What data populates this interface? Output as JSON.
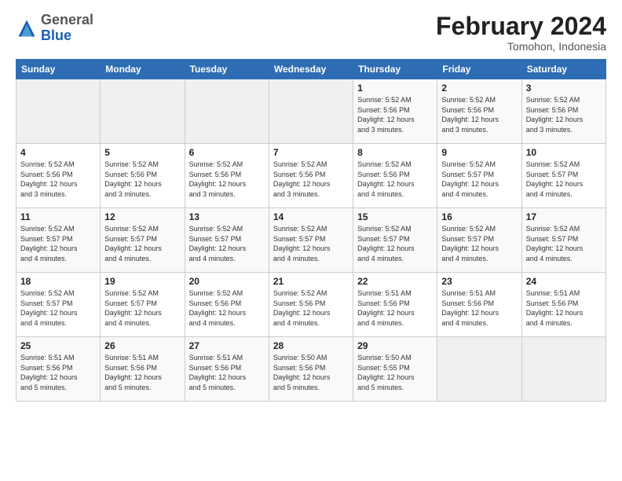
{
  "header": {
    "logo_general": "General",
    "logo_blue": "Blue",
    "month_title": "February 2024",
    "location": "Tomohon, Indonesia"
  },
  "days_of_week": [
    "Sunday",
    "Monday",
    "Tuesday",
    "Wednesday",
    "Thursday",
    "Friday",
    "Saturday"
  ],
  "weeks": [
    [
      {
        "day": "",
        "info": ""
      },
      {
        "day": "",
        "info": ""
      },
      {
        "day": "",
        "info": ""
      },
      {
        "day": "",
        "info": ""
      },
      {
        "day": "1",
        "info": "Sunrise: 5:52 AM\nSunset: 5:56 PM\nDaylight: 12 hours\nand 3 minutes."
      },
      {
        "day": "2",
        "info": "Sunrise: 5:52 AM\nSunset: 5:56 PM\nDaylight: 12 hours\nand 3 minutes."
      },
      {
        "day": "3",
        "info": "Sunrise: 5:52 AM\nSunset: 5:56 PM\nDaylight: 12 hours\nand 3 minutes."
      }
    ],
    [
      {
        "day": "4",
        "info": "Sunrise: 5:52 AM\nSunset: 5:56 PM\nDaylight: 12 hours\nand 3 minutes."
      },
      {
        "day": "5",
        "info": "Sunrise: 5:52 AM\nSunset: 5:56 PM\nDaylight: 12 hours\nand 3 minutes."
      },
      {
        "day": "6",
        "info": "Sunrise: 5:52 AM\nSunset: 5:56 PM\nDaylight: 12 hours\nand 3 minutes."
      },
      {
        "day": "7",
        "info": "Sunrise: 5:52 AM\nSunset: 5:56 PM\nDaylight: 12 hours\nand 3 minutes."
      },
      {
        "day": "8",
        "info": "Sunrise: 5:52 AM\nSunset: 5:56 PM\nDaylight: 12 hours\nand 4 minutes."
      },
      {
        "day": "9",
        "info": "Sunrise: 5:52 AM\nSunset: 5:57 PM\nDaylight: 12 hours\nand 4 minutes."
      },
      {
        "day": "10",
        "info": "Sunrise: 5:52 AM\nSunset: 5:57 PM\nDaylight: 12 hours\nand 4 minutes."
      }
    ],
    [
      {
        "day": "11",
        "info": "Sunrise: 5:52 AM\nSunset: 5:57 PM\nDaylight: 12 hours\nand 4 minutes."
      },
      {
        "day": "12",
        "info": "Sunrise: 5:52 AM\nSunset: 5:57 PM\nDaylight: 12 hours\nand 4 minutes."
      },
      {
        "day": "13",
        "info": "Sunrise: 5:52 AM\nSunset: 5:57 PM\nDaylight: 12 hours\nand 4 minutes."
      },
      {
        "day": "14",
        "info": "Sunrise: 5:52 AM\nSunset: 5:57 PM\nDaylight: 12 hours\nand 4 minutes."
      },
      {
        "day": "15",
        "info": "Sunrise: 5:52 AM\nSunset: 5:57 PM\nDaylight: 12 hours\nand 4 minutes."
      },
      {
        "day": "16",
        "info": "Sunrise: 5:52 AM\nSunset: 5:57 PM\nDaylight: 12 hours\nand 4 minutes."
      },
      {
        "day": "17",
        "info": "Sunrise: 5:52 AM\nSunset: 5:57 PM\nDaylight: 12 hours\nand 4 minutes."
      }
    ],
    [
      {
        "day": "18",
        "info": "Sunrise: 5:52 AM\nSunset: 5:57 PM\nDaylight: 12 hours\nand 4 minutes."
      },
      {
        "day": "19",
        "info": "Sunrise: 5:52 AM\nSunset: 5:57 PM\nDaylight: 12 hours\nand 4 minutes."
      },
      {
        "day": "20",
        "info": "Sunrise: 5:52 AM\nSunset: 5:56 PM\nDaylight: 12 hours\nand 4 minutes."
      },
      {
        "day": "21",
        "info": "Sunrise: 5:52 AM\nSunset: 5:56 PM\nDaylight: 12 hours\nand 4 minutes."
      },
      {
        "day": "22",
        "info": "Sunrise: 5:51 AM\nSunset: 5:56 PM\nDaylight: 12 hours\nand 4 minutes."
      },
      {
        "day": "23",
        "info": "Sunrise: 5:51 AM\nSunset: 5:56 PM\nDaylight: 12 hours\nand 4 minutes."
      },
      {
        "day": "24",
        "info": "Sunrise: 5:51 AM\nSunset: 5:56 PM\nDaylight: 12 hours\nand 4 minutes."
      }
    ],
    [
      {
        "day": "25",
        "info": "Sunrise: 5:51 AM\nSunset: 5:56 PM\nDaylight: 12 hours\nand 5 minutes."
      },
      {
        "day": "26",
        "info": "Sunrise: 5:51 AM\nSunset: 5:56 PM\nDaylight: 12 hours\nand 5 minutes."
      },
      {
        "day": "27",
        "info": "Sunrise: 5:51 AM\nSunset: 5:56 PM\nDaylight: 12 hours\nand 5 minutes."
      },
      {
        "day": "28",
        "info": "Sunrise: 5:50 AM\nSunset: 5:56 PM\nDaylight: 12 hours\nand 5 minutes."
      },
      {
        "day": "29",
        "info": "Sunrise: 5:50 AM\nSunset: 5:55 PM\nDaylight: 12 hours\nand 5 minutes."
      },
      {
        "day": "",
        "info": ""
      },
      {
        "day": "",
        "info": ""
      }
    ]
  ]
}
